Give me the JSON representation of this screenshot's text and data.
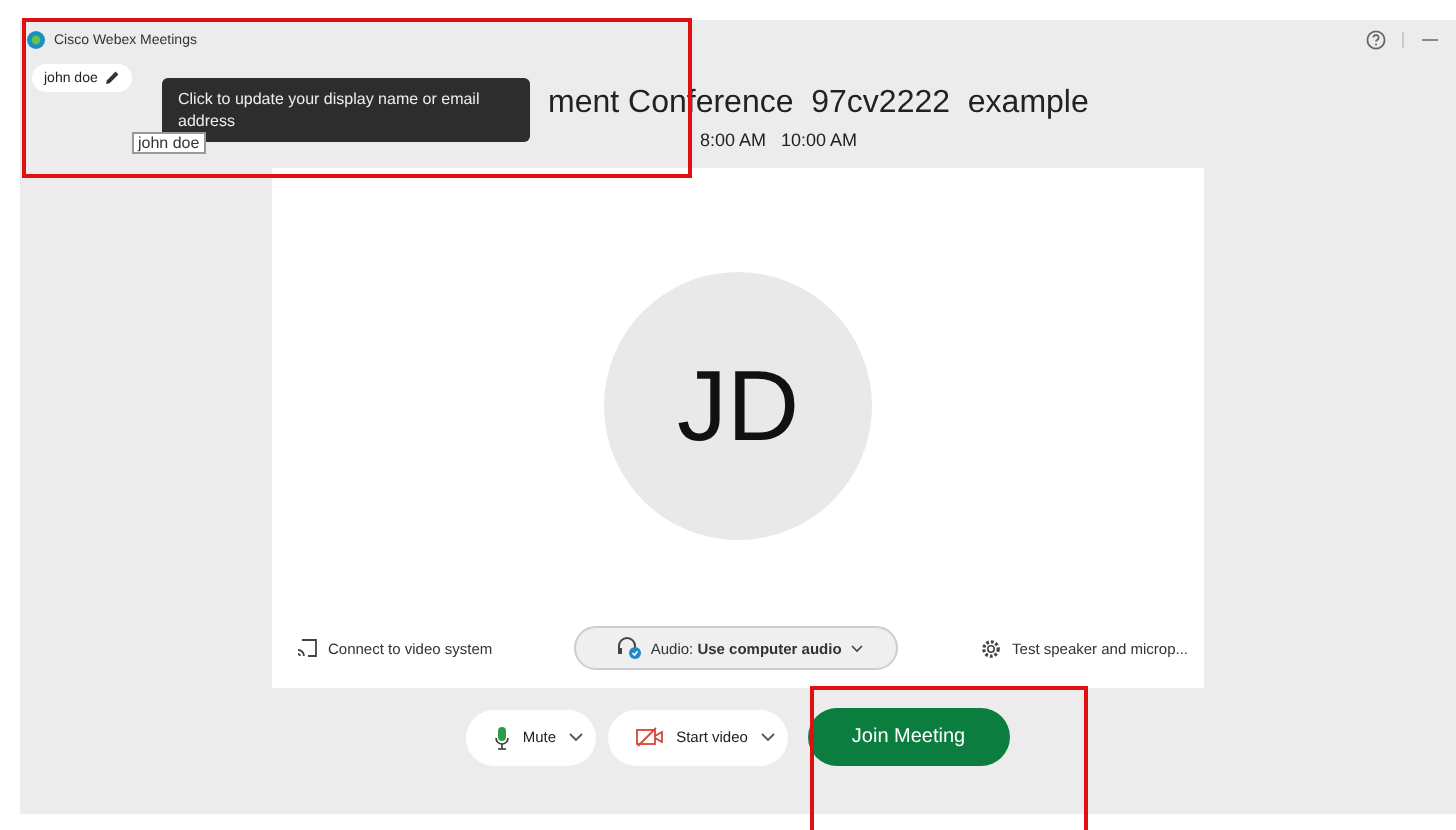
{
  "window": {
    "title": "Cisco Webex Meetings"
  },
  "display_name": {
    "label": "john doe"
  },
  "tooltip": {
    "text": "Click to update your display name or email address"
  },
  "name_hint": {
    "text": "john doe"
  },
  "meeting": {
    "title": "ment Conference  97cv2222  example",
    "time": "8:00 AM   10:00 AM"
  },
  "avatar": {
    "initials": "JD"
  },
  "options": [
    {
      "kind": "cast",
      "label": "Connect to video system"
    },
    {
      "kind": "audio",
      "label": "Audio: **Use computer audio**"
    },
    {
      "kind": "settings",
      "label": "Test speaker and microp..."
    }
  ],
  "controls": [
    {
      "kind": "mic",
      "label": "Mute"
    },
    {
      "kind": "video",
      "label": "Start video"
    },
    {
      "kind": "join",
      "label": "Join Meeting"
    }
  ]
}
